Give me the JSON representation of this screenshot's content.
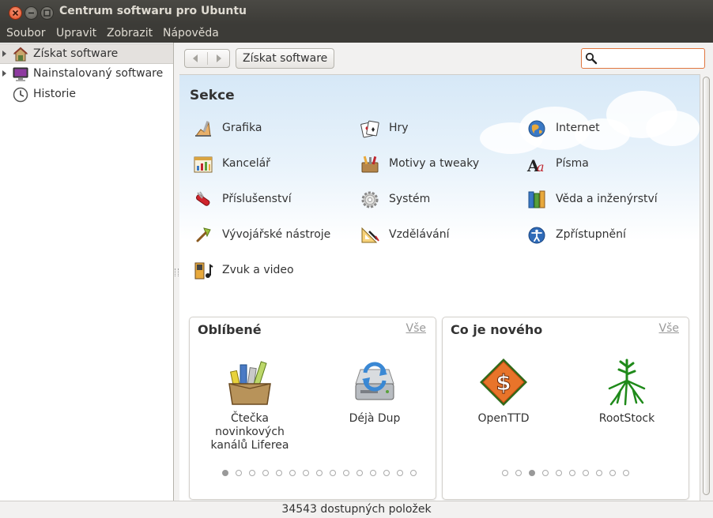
{
  "window": {
    "title": "Centrum softwaru pro Ubuntu"
  },
  "menu": [
    "Soubor",
    "Upravit",
    "Zobrazit",
    "Nápověda"
  ],
  "sidebar": {
    "items": [
      {
        "label": "Získat software",
        "icon": "software-center-icon",
        "selected": true,
        "expandable": true
      },
      {
        "label": "Nainstalovaný software",
        "icon": "monitor-icon",
        "selected": false,
        "expandable": true
      },
      {
        "label": "Historie",
        "icon": "clock-icon",
        "selected": false,
        "expandable": false
      }
    ]
  },
  "toolbar": {
    "breadcrumb": "Získat software",
    "search": {
      "value": "",
      "placeholder": ""
    }
  },
  "sections": {
    "title": "Sekce",
    "categories": [
      {
        "label": "Grafika",
        "icon": "graphics-icon"
      },
      {
        "label": "Hry",
        "icon": "cards-icon"
      },
      {
        "label": "Internet",
        "icon": "globe-icon"
      },
      {
        "label": "Kancelář",
        "icon": "office-icon"
      },
      {
        "label": "Motivy a tweaky",
        "icon": "themes-icon"
      },
      {
        "label": "Písma",
        "icon": "fonts-icon"
      },
      {
        "label": "Příslušenství",
        "icon": "accessories-icon"
      },
      {
        "label": "Systém",
        "icon": "system-gear-icon"
      },
      {
        "label": "Věda a inženýrství",
        "icon": "science-books-icon"
      },
      {
        "label": "Vývojářské nástroje",
        "icon": "developer-trowel-icon"
      },
      {
        "label": "Vzdělávání",
        "icon": "education-icon"
      },
      {
        "label": "Zpřístupnění",
        "icon": "accessibility-icon"
      },
      {
        "label": "Zvuk a video",
        "icon": "sound-video-icon"
      }
    ]
  },
  "featured": {
    "title": "Oblíbené",
    "see_all": "Vše",
    "apps": [
      {
        "label": "Čtečka novinkových kanálů Liferea",
        "icon": "liferea-icon"
      },
      {
        "label": "Déjà Dup",
        "icon": "deja-dup-icon"
      }
    ],
    "pages": 15,
    "active_page": 0
  },
  "whats_new": {
    "title": "Co je nového",
    "see_all": "Vše",
    "apps": [
      {
        "label": "OpenTTD",
        "icon": "openttd-icon"
      },
      {
        "label": "RootStock",
        "icon": "rootstock-icon"
      }
    ],
    "pages": 10,
    "active_page": 2
  },
  "status": {
    "text": "34543 dostupných položek"
  },
  "colors": {
    "titlebar": "#3c3b37",
    "accent": "#e0763f",
    "close_button": "#e2491f"
  }
}
